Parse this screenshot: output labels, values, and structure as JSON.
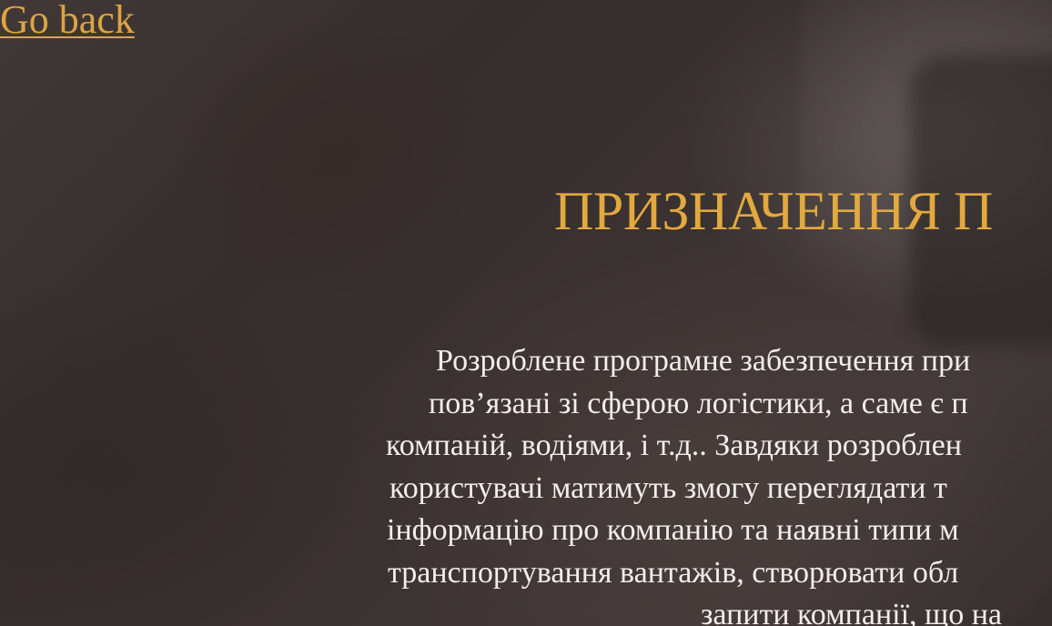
{
  "nav": {
    "go_back_label": "Go back"
  },
  "main": {
    "heading": "ПРИЗНАЧЕННЯ П",
    "paragraph_lines": [
      "Розроблене програмне забезпечення при",
      "пов’язані зі сферою логістики, а саме є п",
      "компаній, водіями, і т.д.. Завдяки розроблен",
      "користувачі матимуть змогу переглядати т",
      "інформацію про компанію та наявні типи м",
      "транспортування вантажів, створювати обл",
      "запити компанії, що на"
    ]
  },
  "colors": {
    "accent": "#e3a93f",
    "link": "#dea443",
    "body_text": "#f2eeec"
  }
}
